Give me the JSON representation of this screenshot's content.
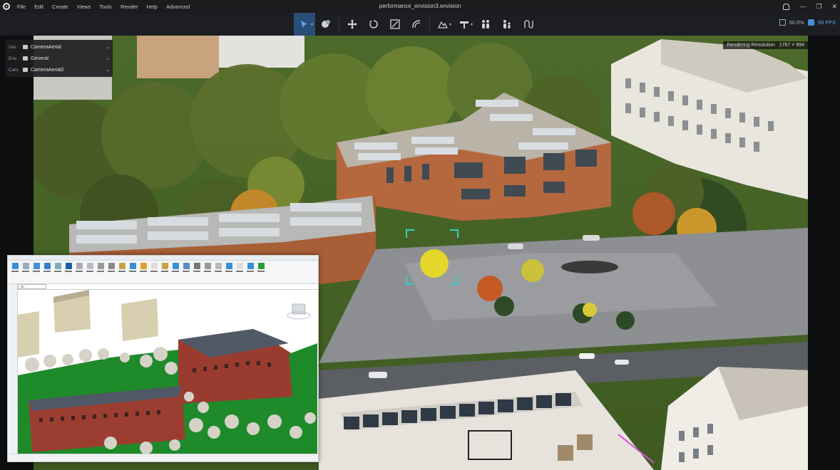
{
  "menubar": {
    "items": [
      "File",
      "Edit",
      "Create",
      "Views",
      "Tools",
      "Render",
      "Help",
      "Advanced"
    ],
    "document_title": "performance_envision3.envision"
  },
  "toolbar": {
    "tools": [
      "select",
      "material-picker",
      "move",
      "rotate",
      "scale",
      "measure",
      "terrain",
      "lighting",
      "people",
      "family",
      "path"
    ]
  },
  "stats": {
    "resolution_scale": "50.0%",
    "fps": "59 FPS"
  },
  "viewport": {
    "rendering_resolution_label": "Rendering Resolution",
    "rendering_resolution_value": "1767 × 994"
  },
  "side_panel": {
    "rows": [
      {
        "key": "Vas",
        "value": "CameraAerial"
      },
      {
        "key": "Env",
        "value": "General"
      },
      {
        "key": "Cam",
        "value": "CameraAerial2"
      }
    ]
  },
  "inset": {
    "view_tab": "3D"
  },
  "colors": {
    "accent": "#2b4e78",
    "accent_light": "#5aa8ff",
    "facade": "#b5683e",
    "grass": "#5f7a34"
  }
}
